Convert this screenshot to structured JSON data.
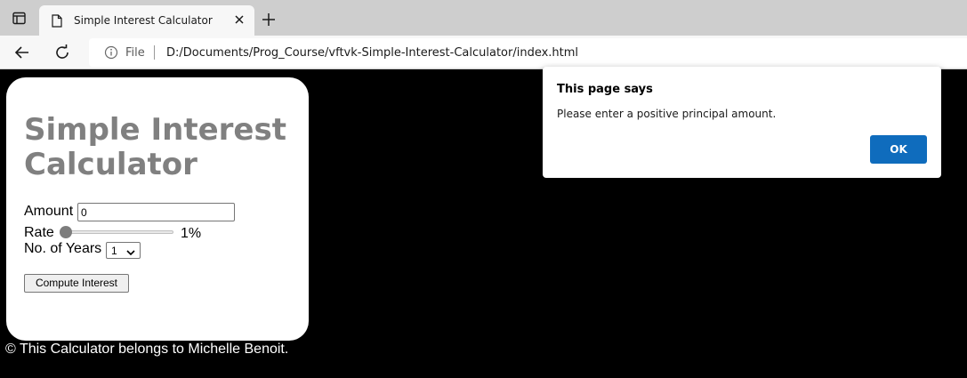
{
  "browser": {
    "tab_title": "Simple Interest Calculator",
    "address_scheme_label": "File",
    "url": "D:/Documents/Prog_Course/vftvk-Simple-Interest-Calculator/index.html"
  },
  "calculator": {
    "title": "Simple Interest Calculator",
    "amount_label": "Amount",
    "amount_value": "0",
    "rate_label": "Rate",
    "rate_value_text": "1%",
    "rate_slider_fraction": 0.0,
    "years_label": "No. of Years",
    "years_selected": "1",
    "compute_button": "Compute Interest"
  },
  "footer": {
    "text": "© This Calculator belongs to Michelle Benoit."
  },
  "alert": {
    "title": "This page says",
    "message": "Please enter a positive principal amount.",
    "ok_label": "OK"
  },
  "colors": {
    "page_background": "#000000",
    "card_background": "#ffffff",
    "title_color": "#808080",
    "ok_button": "#0f6cbd"
  }
}
